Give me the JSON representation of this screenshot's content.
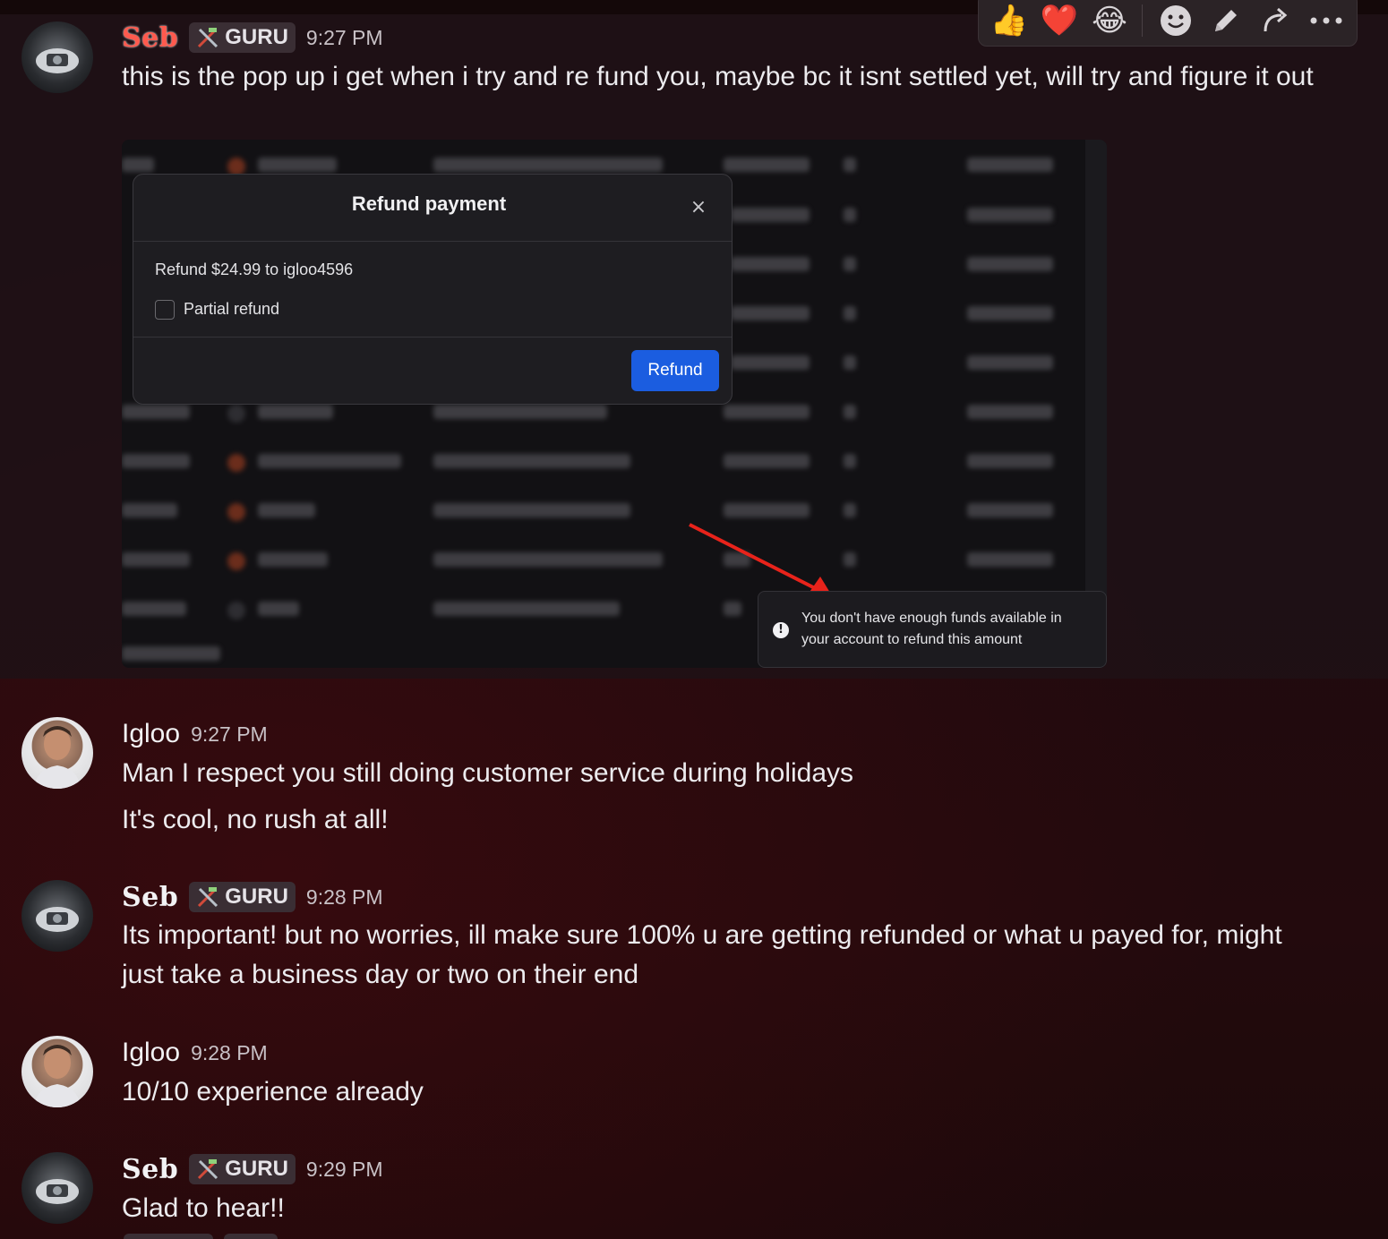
{
  "toolbar": {
    "reactions": [
      "👍",
      "❤️",
      "😂"
    ],
    "icons": [
      "smiley-icon",
      "pencil-icon",
      "reply-arrow-icon",
      "more-icon"
    ]
  },
  "messages": [
    {
      "author": "Seb",
      "badge": "GURU",
      "time": "9:27 PM",
      "text": "this is the pop up i get when i try and re fund you, maybe bc it isnt settled yet, will try and figure it out"
    },
    {
      "author": "Igloo",
      "time": "9:27 PM",
      "text1": "Man I respect you still doing customer service during holidays",
      "text2": "It's cool, no rush at all!"
    },
    {
      "author": "Seb",
      "badge": "GURU",
      "time": "9:28 PM",
      "text": "Its important! but no worries, ill make sure 100% u are getting refunded or what u payed for, might just take a business day or two on their end"
    },
    {
      "author": "Igloo",
      "time": "9:28 PM",
      "text": "10/10 experience already"
    },
    {
      "author": "Seb",
      "badge": "GURU",
      "time": "9:29 PM",
      "text": "Glad to hear!!"
    }
  ],
  "attachment": {
    "modal": {
      "title": "Refund payment",
      "close": "×",
      "body": "Refund $24.99 to igloo4596",
      "checkbox_label": "Partial refund",
      "button": "Refund"
    },
    "toast": {
      "icon": "!",
      "text": "You don't have enough funds available in your account to refund this amount"
    },
    "arrow_color": "#e8231b"
  },
  "colors": {
    "seb_name": "#ff5a4e",
    "refund_button": "#1b5de0"
  }
}
